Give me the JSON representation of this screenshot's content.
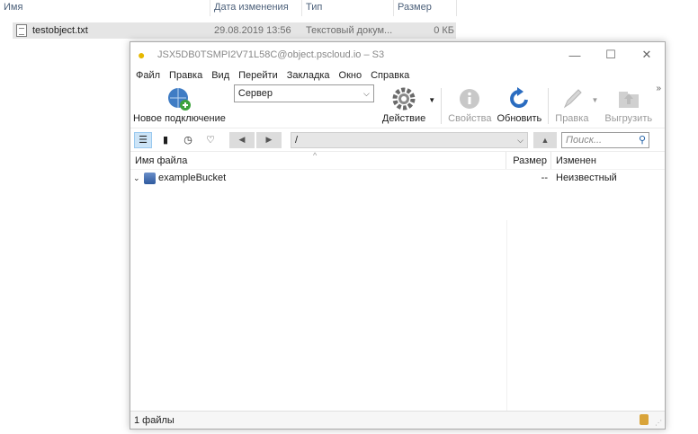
{
  "explorer": {
    "columns": [
      "Имя",
      "Дата изменения",
      "Тип",
      "Размер"
    ],
    "file": {
      "name": "testobject.txt",
      "date": "29.08.2019 13:56",
      "type": "Текстовый докум...",
      "size": "0 КБ"
    }
  },
  "window": {
    "title": "JSX5DB0TSMPI2V71L58C@object.pscloud.io – S3",
    "menu": [
      "Файл",
      "Правка",
      "Вид",
      "Перейти",
      "Закладка",
      "Окно",
      "Справка"
    ],
    "toolbar": {
      "new_connection": "Новое подключение",
      "server": "Сервер",
      "action": "Действие",
      "properties": "Свойства",
      "refresh": "Обновить",
      "edit": "Правка",
      "upload": "Выгрузить"
    },
    "nav": {
      "path": "/",
      "search_placeholder": "Поиск..."
    },
    "columns": {
      "name": "Имя файла",
      "size": "Размер",
      "modified": "Изменен"
    },
    "rows": [
      {
        "name": "exampleBucket",
        "size": "--",
        "modified": "Неизвестный"
      }
    ],
    "status": "1 файлы"
  },
  "colors": {
    "accent": "#1f5fa6",
    "selected_row": "#e5e5e5"
  }
}
